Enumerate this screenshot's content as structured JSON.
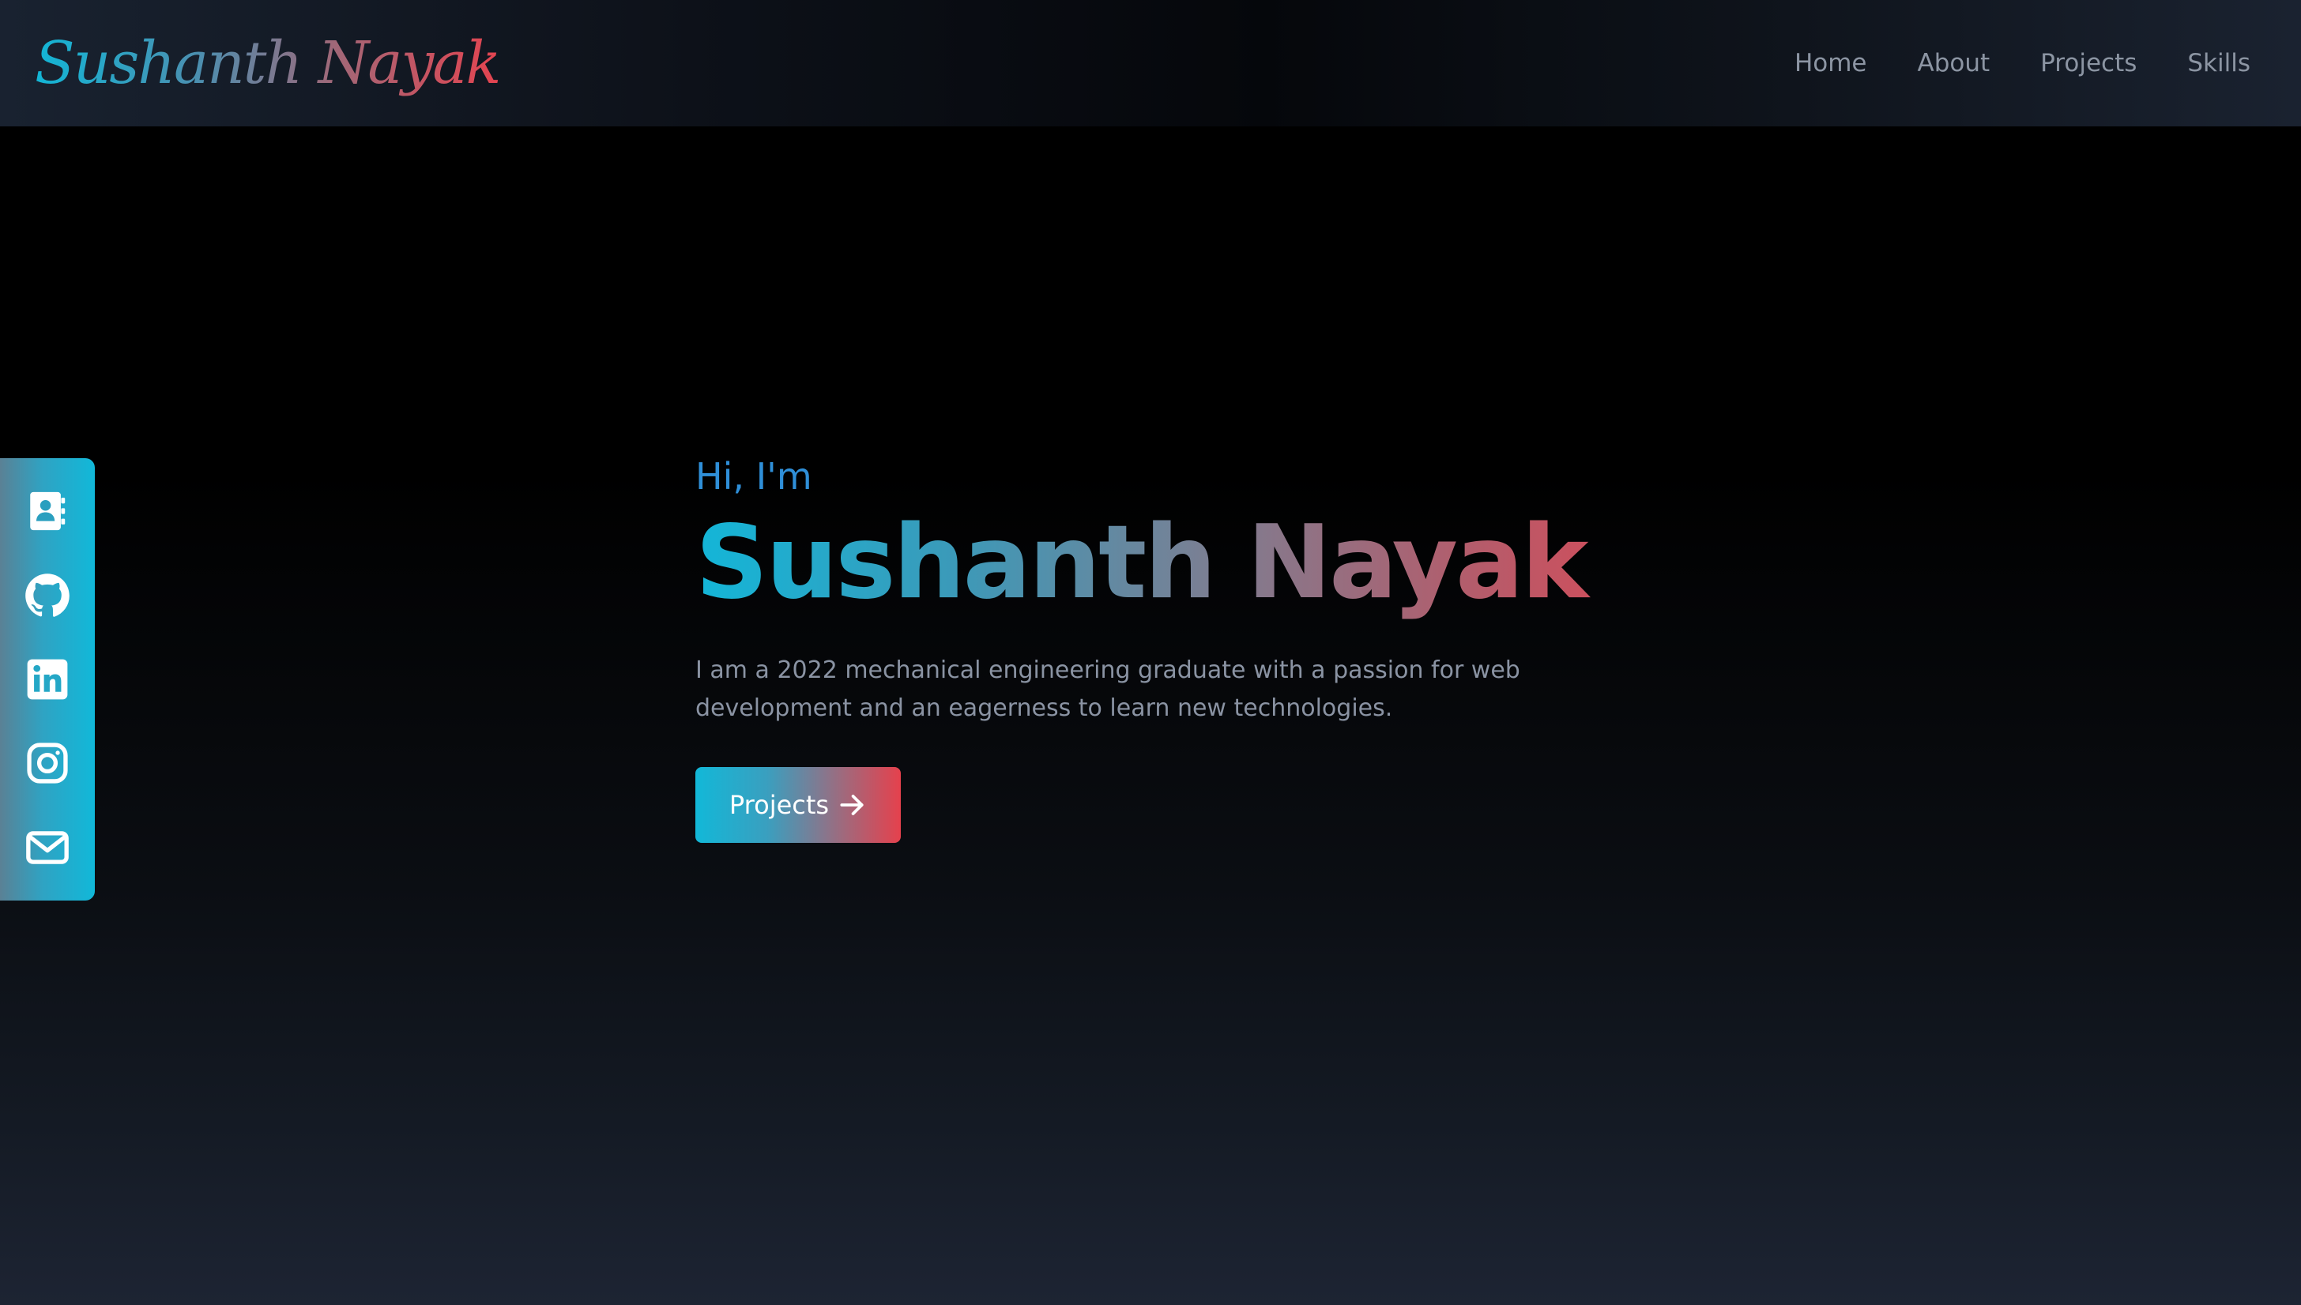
{
  "navbar": {
    "logo": "Sushanth Nayak",
    "links": [
      {
        "label": "Home"
      },
      {
        "label": "About"
      },
      {
        "label": "Projects"
      },
      {
        "label": "Skills"
      }
    ]
  },
  "social": {
    "icons": [
      "contact-card-icon",
      "github-icon",
      "linkedin-icon",
      "instagram-icon",
      "mail-icon"
    ],
    "background_gradient": [
      "#5a8195",
      "#11b8d9"
    ]
  },
  "hero": {
    "greeting": "Hi, I'm",
    "name": "Sushanth Nayak",
    "bio": "I am a 2022 mechanical engineering graduate with a passion for web development and an eagerness to learn new technologies.",
    "cta_label": "Projects",
    "cta_icon": "arrow-right-icon"
  },
  "colors": {
    "accent_cyan": "#12b6d6",
    "accent_red": "#e5434f",
    "greeting_blue": "#2f8fd8",
    "muted_text": "#8a93a3",
    "background": "#000000"
  }
}
